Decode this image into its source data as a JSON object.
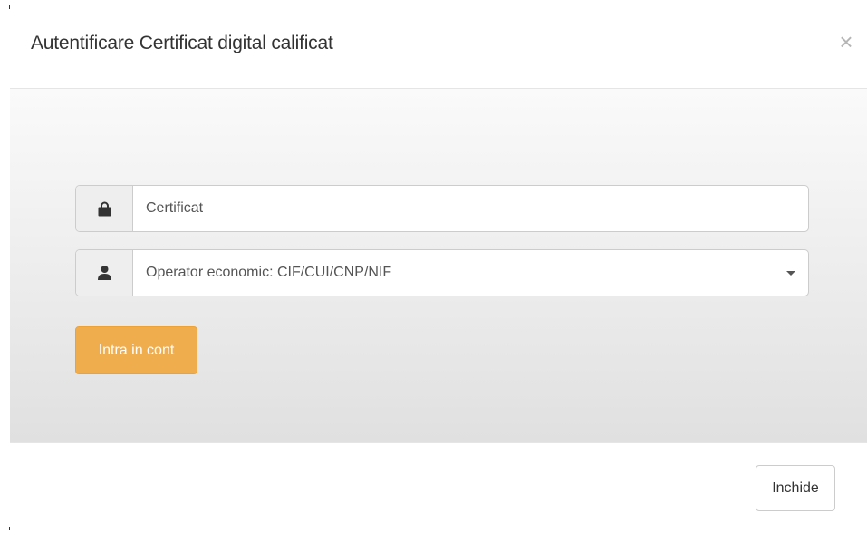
{
  "modal": {
    "title": "Autentificare Certificat digital calificat",
    "close_symbol": "×"
  },
  "form": {
    "certificate": {
      "placeholder": "Certificat",
      "icon": "lock-icon"
    },
    "operator": {
      "placeholder": "Operator economic: CIF/CUI/CNP/NIF",
      "icon": "user-icon"
    },
    "login_label": "Intra in cont"
  },
  "footer": {
    "close_label": "Inchide"
  },
  "colors": {
    "accent": "#f0ad4e",
    "heading_fragment": "#2a78b8"
  }
}
